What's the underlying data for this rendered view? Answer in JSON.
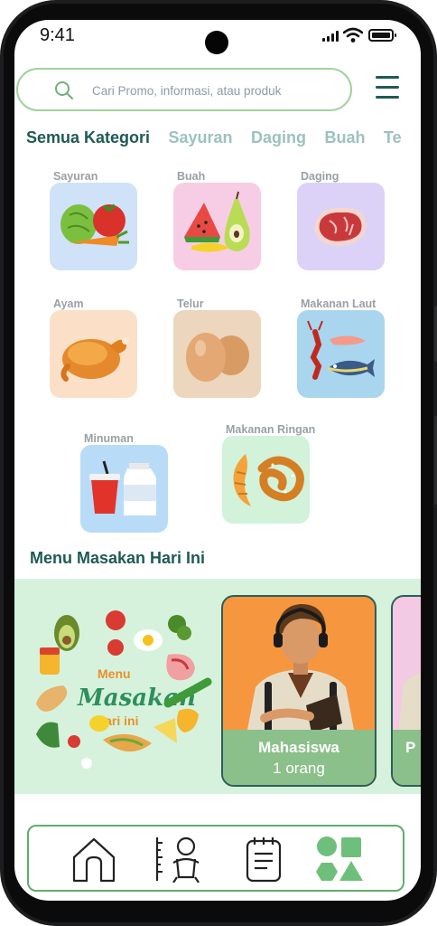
{
  "status_bar": {
    "time": "9:41"
  },
  "search": {
    "placeholder": "Cari Promo, informasi, atau produk",
    "icon": "search-icon"
  },
  "header": {
    "menu_icon": "hamburger-menu-icon"
  },
  "category_tabs": [
    {
      "label": "Semua Kategori",
      "active": true
    },
    {
      "label": "Sayuran",
      "active": false
    },
    {
      "label": "Daging",
      "active": false
    },
    {
      "label": "Buah",
      "active": false
    },
    {
      "label": "Te",
      "active": false
    }
  ],
  "categories": [
    {
      "label": "Sayuran",
      "color": "#cfe2f7",
      "icon": "vegetables-icon"
    },
    {
      "label": "Buah",
      "color": "#f7cde5",
      "icon": "fruit-icon"
    },
    {
      "label": "Daging",
      "color": "#dcd2f7",
      "icon": "meat-icon"
    },
    {
      "label": "Ayam",
      "color": "#fbe0c7",
      "icon": "roast-chicken-icon"
    },
    {
      "label": "Telur",
      "color": "#ecd6bd",
      "icon": "eggs-icon"
    },
    {
      "label": "Makanan Laut",
      "color": "#a9d5ee",
      "icon": "seafood-icon"
    },
    {
      "label": "Minuman",
      "color": "#b8dcf7",
      "icon": "drinks-icon"
    },
    {
      "label": "Makanan Ringan",
      "color": "#d2f2d9",
      "icon": "snacks-icon"
    }
  ],
  "menu_section": {
    "title": "Menu Masakan Hari Ini",
    "banner": {
      "line1": "Menu",
      "line2": "Masakan",
      "line3": "Hari ini"
    },
    "cards": [
      {
        "role": "Mahasiswa",
        "count": "1 orang",
        "color": "#f6963f"
      },
      {
        "role": "P",
        "count": "",
        "color": "#f3c9e3"
      }
    ]
  },
  "bottom_nav": [
    {
      "icon": "home-icon"
    },
    {
      "icon": "baby-growth-icon"
    },
    {
      "icon": "notes-icon"
    },
    {
      "icon": "categories-shapes-icon"
    }
  ],
  "colors": {
    "primary": "#1f5a55",
    "accent": "#5fae6c",
    "banner_bg": "#d6f2dc"
  }
}
